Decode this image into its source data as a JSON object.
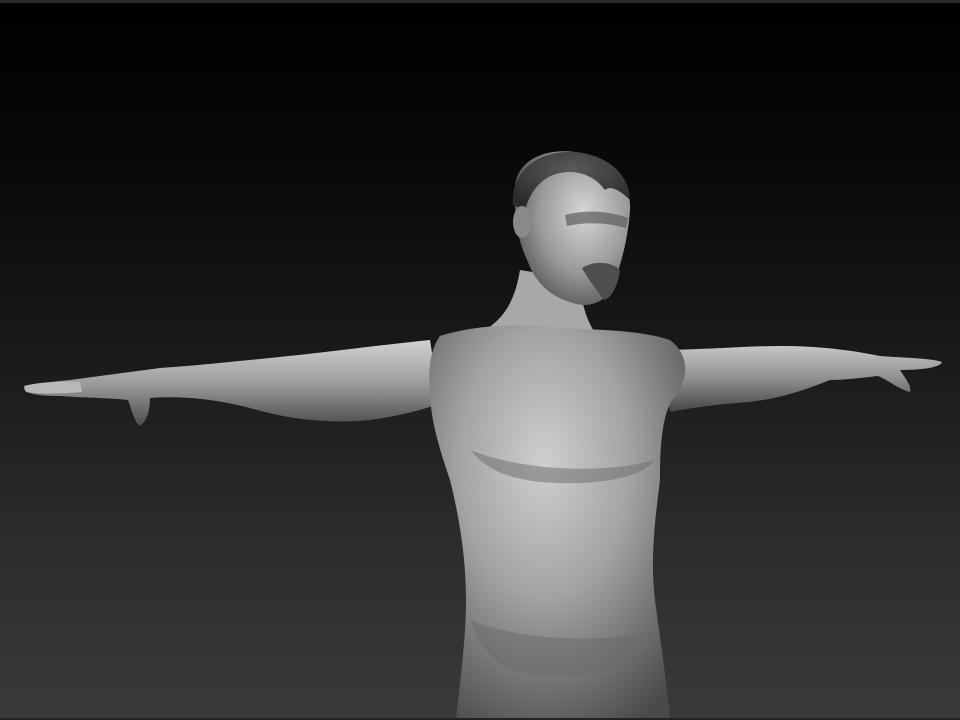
{
  "viewport": {
    "background_top": "#000000",
    "background_bottom": "#3a3a3a",
    "model": {
      "material_base": "#9a9a9a",
      "material_highlight": "#d9d9d9",
      "material_shadow": "#3c3c3c",
      "pose": "T-pose",
      "icon": "sculpt-mesh-icon"
    }
  }
}
